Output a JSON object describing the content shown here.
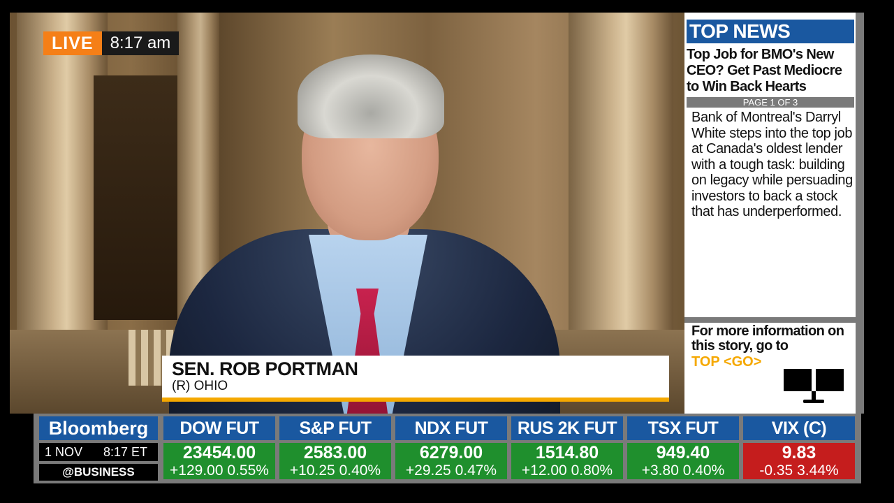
{
  "live_badge": {
    "label": "LIVE",
    "time": "8:17 am"
  },
  "lower_third": {
    "name": "SEN. ROB PORTMAN",
    "subtitle": "(R) OHIO"
  },
  "top_news": {
    "header": "TOP NEWS",
    "headline": "Top Job for BMO's New CEO? Get Past Mediocre to Win Back Hearts",
    "page_indicator": "PAGE 1 OF 3",
    "body": "Bank of Montreal's Darryl White steps into the top job at Canada's oldest lender with a tough task: building on legacy while persuading investors to back a stock that has underperformed.",
    "more_info": "For more information on this story, go to",
    "command": "TOP <GO>",
    "icon": "dual-monitor-icon"
  },
  "ticker": {
    "brand": "Bloomberg",
    "date": "1 NOV",
    "time": "8:17 ET",
    "handle": "@BUSINESS",
    "items": [
      {
        "name": "DOW FUT",
        "value": "23454.00",
        "change": "+129.00",
        "pct": "0.55%",
        "direction": "up"
      },
      {
        "name": "S&P FUT",
        "value": "2583.00",
        "change": "+10.25",
        "pct": "0.40%",
        "direction": "up"
      },
      {
        "name": "NDX FUT",
        "value": "6279.00",
        "change": "+29.25",
        "pct": "0.47%",
        "direction": "up"
      },
      {
        "name": "RUS 2K FUT",
        "value": "1514.80",
        "change": "+12.00",
        "pct": "0.80%",
        "direction": "up"
      },
      {
        "name": "TSX FUT",
        "value": "949.40",
        "change": "+3.80",
        "pct": "0.40%",
        "direction": "up"
      },
      {
        "name": "VIX (C)",
        "value": "9.83",
        "change": "-0.35",
        "pct": "3.44%",
        "direction": "down"
      }
    ]
  },
  "colors": {
    "accent_orange": "#f57f17",
    "bloomberg_blue": "#1a58a0",
    "up_green": "#1f8f2d",
    "down_red": "#c51d1d",
    "lower_third_bar": "#f5a800"
  }
}
